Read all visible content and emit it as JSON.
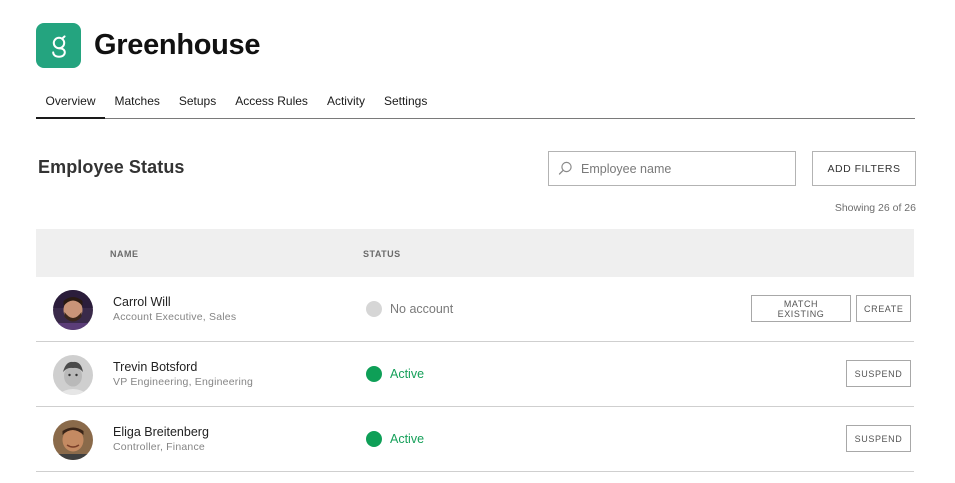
{
  "app": {
    "title": "Greenhouse",
    "logo_letter": "g",
    "brand_color": "#24a47f"
  },
  "tabs": [
    {
      "label": "Overview",
      "active": true
    },
    {
      "label": "Matches"
    },
    {
      "label": "Setups"
    },
    {
      "label": "Access Rules"
    },
    {
      "label": "Activity"
    },
    {
      "label": "Settings"
    }
  ],
  "section": {
    "title": "Employee Status",
    "search_placeholder": "Employee name",
    "search_icon": "search-icon",
    "filter_button": "ADD FILTERS",
    "showing": "Showing 26 of 26"
  },
  "table": {
    "headers": {
      "name": "NAME",
      "status": "STATUS"
    },
    "rows": [
      {
        "name": "Carrol Will",
        "role": "Account Executive, Sales",
        "status": "No account",
        "status_color": "#7a7a7a",
        "dot_color": "#d6d6d6",
        "actions": [
          "MATCH EXISTING",
          "CREATE"
        ]
      },
      {
        "name": "Trevin Botsford",
        "role": "VP Engineering, Engineering",
        "status": "Active",
        "status_color": "#16a05a",
        "dot_color": "#0e9f57",
        "actions": [
          "SUSPEND"
        ]
      },
      {
        "name": "Eliga Breitenberg",
        "role": "Controller, Finance",
        "status": "Active",
        "status_color": "#16a05a",
        "dot_color": "#0e9f57",
        "actions": [
          "SUSPEND"
        ]
      }
    ]
  }
}
